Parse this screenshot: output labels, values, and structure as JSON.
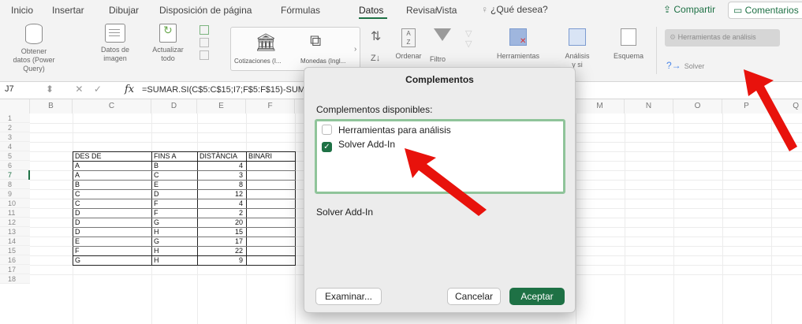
{
  "ribbon_tabs": [
    {
      "label": "Inicio"
    },
    {
      "label": "Insertar"
    },
    {
      "label": "Dibujar"
    },
    {
      "label": "Disposición de página"
    },
    {
      "label": "Fórmulas"
    },
    {
      "label": "Datos",
      "active": true
    },
    {
      "label": "Revisar"
    },
    {
      "label": "Vista"
    }
  ],
  "search": {
    "label": "¿Qué desea?",
    "icon": "lightbulb-icon"
  },
  "share": {
    "label": "Compartir",
    "icon": "share-icon"
  },
  "comments": {
    "label": "Comentarios",
    "icon": "comment-icon"
  },
  "ribbon": {
    "get_data": "Obtener\ndatos (Power Query)",
    "from_image": "Datos de\nimagen",
    "refresh_all": "Actualizar\ntodo",
    "stocks": "Cotizaciones (I...",
    "currencies": "Monedas (Ingl...",
    "sort": "Ordenar",
    "filter": "Filtro",
    "tools": "Herramientas",
    "what_if": "Análisis\nde hipótesis",
    "what_if_visible": "Análisis\ny si",
    "outline": "Esquema",
    "analysis_tools": "Herramientas de análisis",
    "solver": "Solver"
  },
  "formula_bar": {
    "cell_ref": "J7",
    "formula": "=SUMAR.SI(C$5:C$15;I7;F$5:F$15)-SUM"
  },
  "columns": [
    "B",
    "C",
    "D",
    "E",
    "F",
    "M",
    "N",
    "O",
    "P",
    "Q"
  ],
  "rows": [
    "1",
    "2",
    "3",
    "4",
    "5",
    "6",
    "7",
    "8",
    "9",
    "10",
    "11",
    "12",
    "13",
    "14",
    "15",
    "16",
    "17",
    "18"
  ],
  "table": {
    "headers": [
      "DES DE",
      "FINS A",
      "DISTÀNCIA",
      "BINARI"
    ],
    "rows": [
      [
        "A",
        "B",
        "4",
        ""
      ],
      [
        "A",
        "C",
        "3",
        ""
      ],
      [
        "B",
        "E",
        "8",
        ""
      ],
      [
        "C",
        "D",
        "12",
        ""
      ],
      [
        "C",
        "F",
        "4",
        ""
      ],
      [
        "D",
        "F",
        "2",
        ""
      ],
      [
        "D",
        "G",
        "20",
        ""
      ],
      [
        "D",
        "H",
        "15",
        ""
      ],
      [
        "E",
        "G",
        "17",
        ""
      ],
      [
        "F",
        "H",
        "22",
        ""
      ],
      [
        "G",
        "H",
        "9",
        ""
      ]
    ]
  },
  "dialog": {
    "title": "Complementos",
    "available_label": "Complementos disponibles:",
    "addins": [
      {
        "label": "Herramientas para análisis",
        "checked": false
      },
      {
        "label": "Solver Add-In",
        "checked": true
      }
    ],
    "description": "Solver Add-In",
    "browse": "Examinar...",
    "cancel": "Cancelar",
    "ok": "Aceptar"
  },
  "colors": {
    "accent_green": "#1e7145",
    "arrow_red": "#e8120c"
  }
}
